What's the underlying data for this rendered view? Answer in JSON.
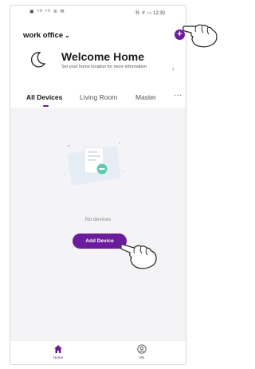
{
  "status_bar": {
    "left": "▣ ⁴ᴳ ⁴ᴳ ≋ ✉",
    "right": "Ⓝ ∦ ▭ 12:30"
  },
  "header": {
    "home_name": "work office",
    "home_chevron": "⌄",
    "add_icon": "+"
  },
  "welcome": {
    "title": "Welcome Home",
    "subtitle": "Set your home location for more information",
    "arrow": "›"
  },
  "tabs": [
    {
      "label": "All Devices"
    },
    {
      "label": "Living Room"
    },
    {
      "label": "Master"
    }
  ],
  "tabs_more": "···",
  "empty_state": {
    "text": "No devices",
    "button_label": "Add Device"
  },
  "bottom_nav": [
    {
      "label": "Home",
      "icon": "home-icon"
    },
    {
      "label": "Me",
      "icon": "profile-icon"
    }
  ],
  "colors": {
    "accent": "#6b1c9c",
    "background": "#f4f4f6"
  }
}
